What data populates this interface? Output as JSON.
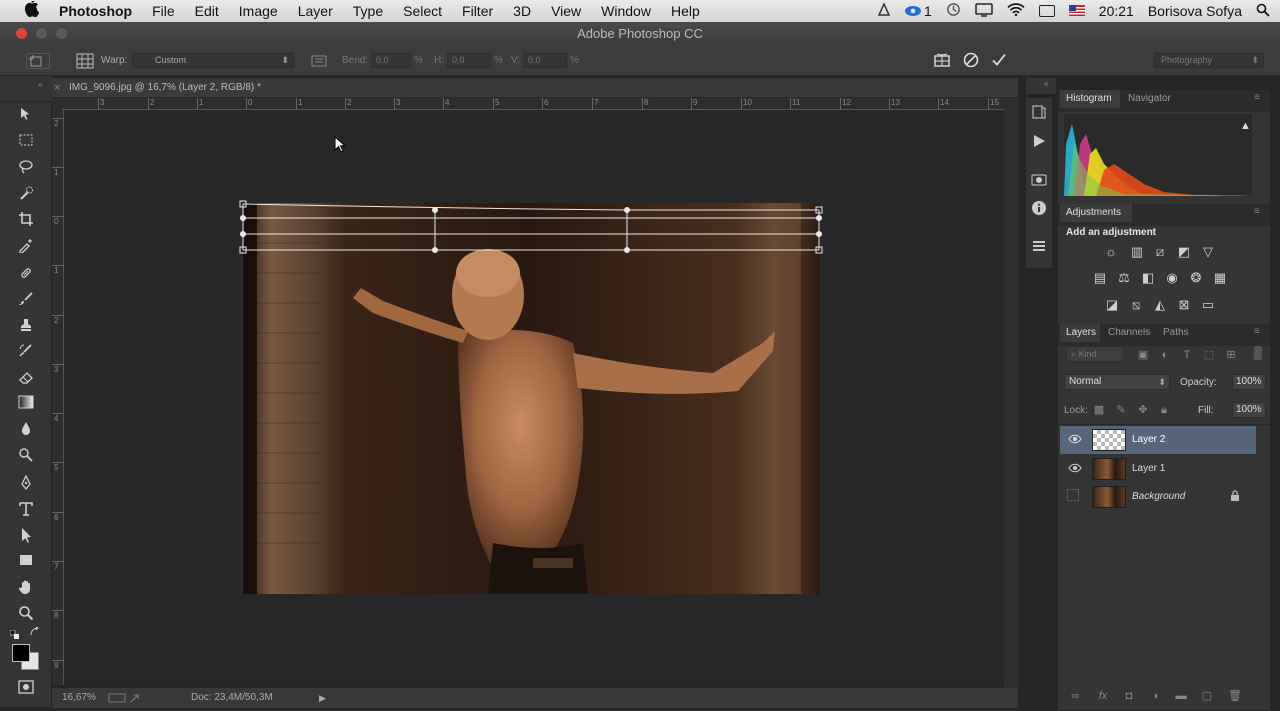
{
  "menubar": {
    "app": "Photoshop",
    "items": [
      "File",
      "Edit",
      "Image",
      "Layer",
      "Type",
      "Select",
      "Filter",
      "3D",
      "View",
      "Window",
      "Help"
    ],
    "badge": "1",
    "time": "20:21",
    "user": "Borisova Sofya"
  },
  "titlebar": {
    "title": "Adobe Photoshop CC"
  },
  "options": {
    "warp_label": "Warp:",
    "warp_value": "Custom",
    "bend_label": "Bend:",
    "bend_value": "0.0",
    "h_label": "H:",
    "h_value": "0.0",
    "v_label": "V:",
    "v_value": "0.0",
    "pct": "%",
    "workspace": "Photography"
  },
  "document": {
    "close_glyph": "×",
    "tab": "IMG_9096.jpg @ 16,7% (Layer 2, RGB/8) *",
    "hruler": [
      "3",
      "2",
      "1",
      "0",
      "1",
      "2",
      "3",
      "4",
      "5",
      "6",
      "7",
      "8",
      "9",
      "10",
      "11",
      "12",
      "13",
      "14",
      "15"
    ],
    "vruler": [
      "2",
      "1",
      "0",
      "1",
      "2",
      "3",
      "4",
      "5",
      "6",
      "7",
      "8",
      "9"
    ],
    "zoom": "16,67%",
    "doc_size": "Doc: 23,4M/50,3M"
  },
  "panels": {
    "histogram_tab": "Histogram",
    "navigator_tab": "Navigator",
    "warning_glyph": "▲",
    "adjustments_tab": "Adjustments",
    "add_adjustment": "Add an adjustment",
    "layers_tab": "Layers",
    "channels_tab": "Channels",
    "paths_tab": "Paths",
    "kind_label": "Kind",
    "blend_mode": "Normal",
    "opacity_label": "Opacity:",
    "opacity_value": "100%",
    "lock_label": "Lock:",
    "fill_label": "Fill:",
    "fill_value": "100%",
    "layers": [
      {
        "name": "Layer 2"
      },
      {
        "name": "Layer 1"
      },
      {
        "name": "Background"
      }
    ]
  }
}
